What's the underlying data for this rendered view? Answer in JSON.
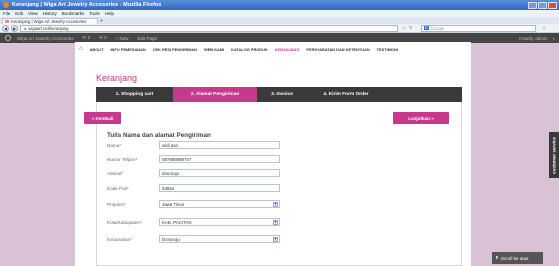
{
  "window": {
    "title": "Keranjang | Wiga Art Jewelry Accesories - Mozilla Firefox"
  },
  "menubar": [
    "File",
    "Edit",
    "View",
    "History",
    "Bookmarks",
    "Tools",
    "Help"
  ],
  "browser_tab": {
    "label": "Keranjang | Wiga Art Jewelry Accesories",
    "favicon": "W",
    "new_tab": "+"
  },
  "url": "wigaart.net/keranjang",
  "search": {
    "placeholder": "Google",
    "engine": "G"
  },
  "admin_bar": {
    "site_name": "Wiga Art Jewelry Accesories",
    "updates": "2",
    "comments": "0",
    "new": "New",
    "edit": "Edit Page",
    "greeting": "Howdy, admin"
  },
  "site_nav": [
    "ABOUT",
    "INFO PEMESANAN",
    "CEK RESI PENGIRIMAN",
    "WEB KAMI",
    "KATALOG PRODUK",
    "KERANJANG",
    "PERSYARATAN DAN KETENTUAN",
    "TESTIMONI"
  ],
  "page_title": "Keranjang",
  "steps": [
    "1. Shopping cart",
    "2. Alamat Pengiriman",
    "3. Invoice",
    "4. Kirim Form Order"
  ],
  "buttons": {
    "back": "« Kembali",
    "next": "Lanjutkan »"
  },
  "form": {
    "title": "Tulis Nama dan alamat Pengiriman",
    "fields": [
      {
        "label": "Nama*",
        "value": "widi asa"
      },
      {
        "label": "Nomor Telpon*",
        "value": "087888888747"
      },
      {
        "label": "Alamat*",
        "value": "donorojo"
      },
      {
        "label": "Kode Pos*",
        "value": "63554"
      },
      {
        "label": "Propinsi*",
        "value": "Jawa Timur"
      },
      {
        "label": "Kota/Kabupaten*",
        "value": "KAB. PACITAN"
      },
      {
        "label": "Kecamatan*",
        "value": "Donorojo"
      }
    ]
  },
  "side_tab": "customer service",
  "scroll_top": "Scroll ke atas",
  "colors": {
    "accent": "#c7398d",
    "dark": "#3a3a3a",
    "background": "#d9c1d6"
  }
}
